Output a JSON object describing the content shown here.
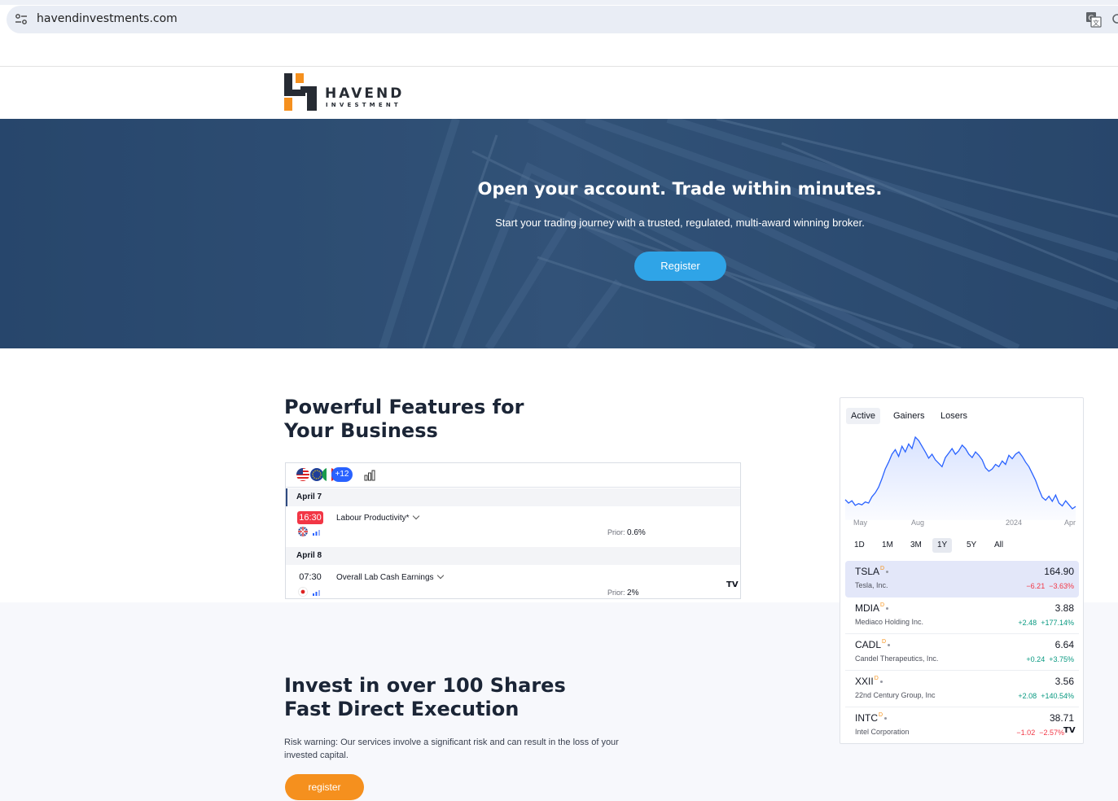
{
  "browser": {
    "url": "havendinvestments.com"
  },
  "logo": {
    "word": "HAVEND",
    "sub": "INVESTMENT",
    "colors": {
      "dark": "#262b33",
      "orange": "#f5901e"
    }
  },
  "hero": {
    "title": "Open your account. Trade within minutes.",
    "subtitle": "Start your trading journey with a trusted, regulated, multi-award winning broker.",
    "button_label": "Register",
    "button_color": "#2fa4e7"
  },
  "features": {
    "title_line1": "Powerful Features for",
    "title_line2": "Your Business"
  },
  "calendar": {
    "extra_countries": "+12",
    "days": [
      {
        "label": "April 7",
        "events": [
          {
            "time": "16:30",
            "time_highlight": true,
            "name": "Labour Productivity*",
            "prior_label": "Prior:",
            "prior_value": "0.6%",
            "country": "gb-flag-icon"
          }
        ]
      },
      {
        "label": "April 8",
        "events": [
          {
            "time": "07:30",
            "time_highlight": false,
            "name": "Overall Lab Cash Earnings",
            "prior_label": "Prior:",
            "prior_value": "2%",
            "country": "jp-flag-icon"
          }
        ]
      }
    ],
    "brand": "TV"
  },
  "invest": {
    "title_line1": "Invest in over 100 Shares",
    "title_line2": "Fast Direct Execution",
    "risk_warning": "Risk warning: Our services involve a significant risk and can result in the loss of your invested capital.",
    "button_label": "register",
    "button_color": "#f5901e"
  },
  "market": {
    "tabs": [
      "Active",
      "Gainers",
      "Losers"
    ],
    "active_tab": "Active",
    "ranges": [
      "1D",
      "1M",
      "3M",
      "1Y",
      "5Y",
      "All"
    ],
    "active_range": "1Y",
    "chart_data": {
      "type": "area",
      "x_labels": [
        "May",
        "Aug",
        "2024",
        "Apr"
      ],
      "values": [
        178,
        172,
        176,
        168,
        171,
        169,
        174,
        172,
        183,
        190,
        200,
        215,
        232,
        244,
        258,
        266,
        254,
        272,
        262,
        276,
        268,
        288,
        282,
        272,
        262,
        251,
        258,
        248,
        242,
        236,
        252,
        260,
        268,
        258,
        264,
        274,
        268,
        258,
        252,
        262,
        256,
        248,
        234,
        228,
        232,
        240,
        236,
        246,
        240,
        256,
        250,
        258,
        262,
        254,
        244,
        236,
        224,
        212,
        196,
        182,
        177,
        184,
        175,
        186,
        172,
        167,
        176,
        169,
        162,
        166
      ],
      "line_color": "#2962ff"
    },
    "stocks": [
      {
        "symbol": "TSLA",
        "name": "Tesla, Inc.",
        "price": "164.90",
        "change": "−6.21",
        "change_pct": "−3.63%",
        "direction": "down"
      },
      {
        "symbol": "MDIA",
        "name": "Mediaco Holding Inc.",
        "price": "3.88",
        "change": "+2.48",
        "change_pct": "+177.14%",
        "direction": "up"
      },
      {
        "symbol": "CADL",
        "name": "Candel Therapeutics, Inc.",
        "price": "6.64",
        "change": "+0.24",
        "change_pct": "+3.75%",
        "direction": "up"
      },
      {
        "symbol": "XXII",
        "name": "22nd Century Group, Inc",
        "price": "3.56",
        "change": "+2.08",
        "change_pct": "+140.54%",
        "direction": "up"
      },
      {
        "symbol": "INTC",
        "name": "Intel Corporation",
        "price": "38.71",
        "change": "−1.02",
        "change_pct": "−2.57%",
        "direction": "down"
      }
    ],
    "delayed_mark": "D",
    "brand": "TV"
  }
}
